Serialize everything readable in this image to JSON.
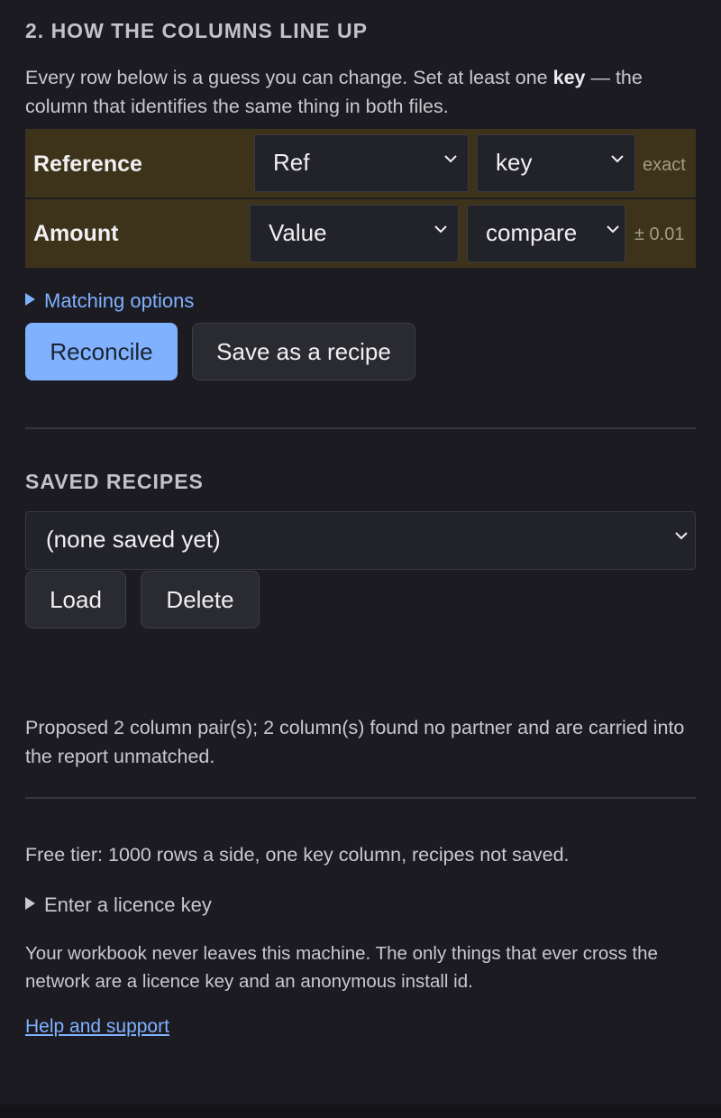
{
  "section": {
    "title": "2. HOW THE COLUMNS LINE UP",
    "intro_before": "Every row below is a guess you can change. Set at least one ",
    "intro_bold": "key",
    "intro_after": " — the column that identifies the same thing in both files."
  },
  "mappings": [
    {
      "column": "Reference",
      "partner": "Ref",
      "role": "key",
      "note": "exact"
    },
    {
      "column": "Amount",
      "partner": "Value",
      "role": "compare",
      "note": "± 0.01"
    }
  ],
  "matching_options": {
    "label": "Matching options"
  },
  "actions": {
    "reconcile_label": "Reconcile",
    "save_recipe_label": "Save as a recipe"
  },
  "recipes": {
    "title": "SAVED RECIPES",
    "selected": "(none saved yet)",
    "load_label": "Load",
    "delete_label": "Delete"
  },
  "status": {
    "message": "Proposed 2 column pair(s); 2 column(s) found no partner and are carried into the report unmatched."
  },
  "footer": {
    "tier": "Free tier: 1000 rows a side, one key column, recipes not saved.",
    "licence_label": "Enter a licence key",
    "privacy": "Your workbook never leaves this machine. The only things that ever cross the network are a licence key and an anonymous install id.",
    "help_link": "Help and support"
  },
  "colors": {
    "background": "#1c1b22",
    "accent": "#7fb1ff",
    "mapping_row_bg": "#3d331b"
  },
  "icons": {
    "select_arrow": "chevron-down-icon",
    "disclosure": "disclosure-triangle-icon"
  }
}
